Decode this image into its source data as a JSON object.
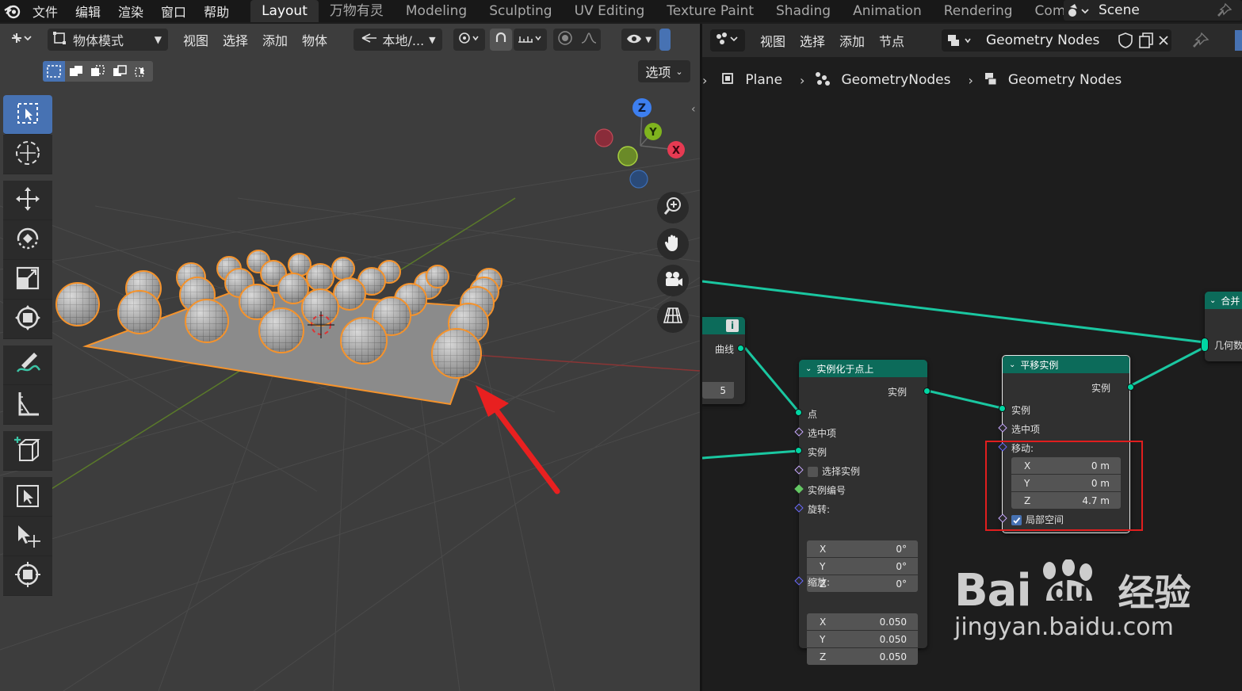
{
  "topbar": {
    "menus": [
      "文件",
      "编辑",
      "渲染",
      "窗口",
      "帮助"
    ],
    "workspace_tabs": [
      "Layout",
      "万物有灵",
      "Modeling",
      "Sculpting",
      "UV Editing",
      "Texture Paint",
      "Shading",
      "Animation",
      "Rendering",
      "Compo"
    ],
    "active_tab": "Layout",
    "scene": "Scene"
  },
  "viewport": {
    "mode": "物体模式",
    "menus": [
      "视图",
      "选择",
      "添加",
      "物体"
    ],
    "transform_orientation": "本地/...",
    "options_label": "选项",
    "tools": [
      "select-box",
      "cursor",
      "move",
      "rotate",
      "scale",
      "transform",
      "annotate",
      "measure",
      "add-cube",
      "transform-extra",
      "move-extra",
      "shear"
    ],
    "gizmo_axes": {
      "x": "X",
      "y": "Y",
      "z": "Z"
    }
  },
  "node_editor": {
    "menus": [
      "视图",
      "选择",
      "添加",
      "节点"
    ],
    "node_group": "Geometry Nodes",
    "breadcrumb": [
      "Plane",
      "GeometryNodes",
      "Geometry Nodes"
    ],
    "nodes": {
      "curve_node": {
        "output_label": "曲线",
        "value": "5"
      },
      "instance_on_points": {
        "title": "实例化于点上",
        "output": "实例",
        "inputs": [
          "点",
          "选中项",
          "实例",
          "选择实例",
          "实例编号"
        ],
        "rotation_label": "旋转:",
        "rotation": [
          {
            "axis": "X",
            "value": "0°"
          },
          {
            "axis": "Y",
            "value": "0°"
          },
          {
            "axis": "Z",
            "value": "0°"
          }
        ],
        "scale_label": "缩放:",
        "scale": [
          {
            "axis": "X",
            "value": "0.050"
          },
          {
            "axis": "Y",
            "value": "0.050"
          },
          {
            "axis": "Z",
            "value": "0.050"
          }
        ]
      },
      "translate_instances": {
        "title": "平移实例",
        "output": "实例",
        "inputs": [
          "实例",
          "选中项"
        ],
        "translation_label": "移动:",
        "translation": [
          {
            "axis": "X",
            "value": "0 m"
          },
          {
            "axis": "Y",
            "value": "0 m"
          },
          {
            "axis": "Z",
            "value": "4.7 m"
          }
        ],
        "local_space_label": "局部空间"
      },
      "join_node": {
        "title": "合并",
        "input": "几何数"
      }
    }
  },
  "watermark": {
    "brand": "Bai",
    "brand2": "du",
    "brand3": "经验",
    "url": "jingyan.baidu.com"
  },
  "colors": {
    "accent": "#4772b3",
    "node_header": "#0c6b5a",
    "link": "#1ac7a1",
    "highlight": "#e01e1e",
    "selected_outline": "#f5932c"
  }
}
